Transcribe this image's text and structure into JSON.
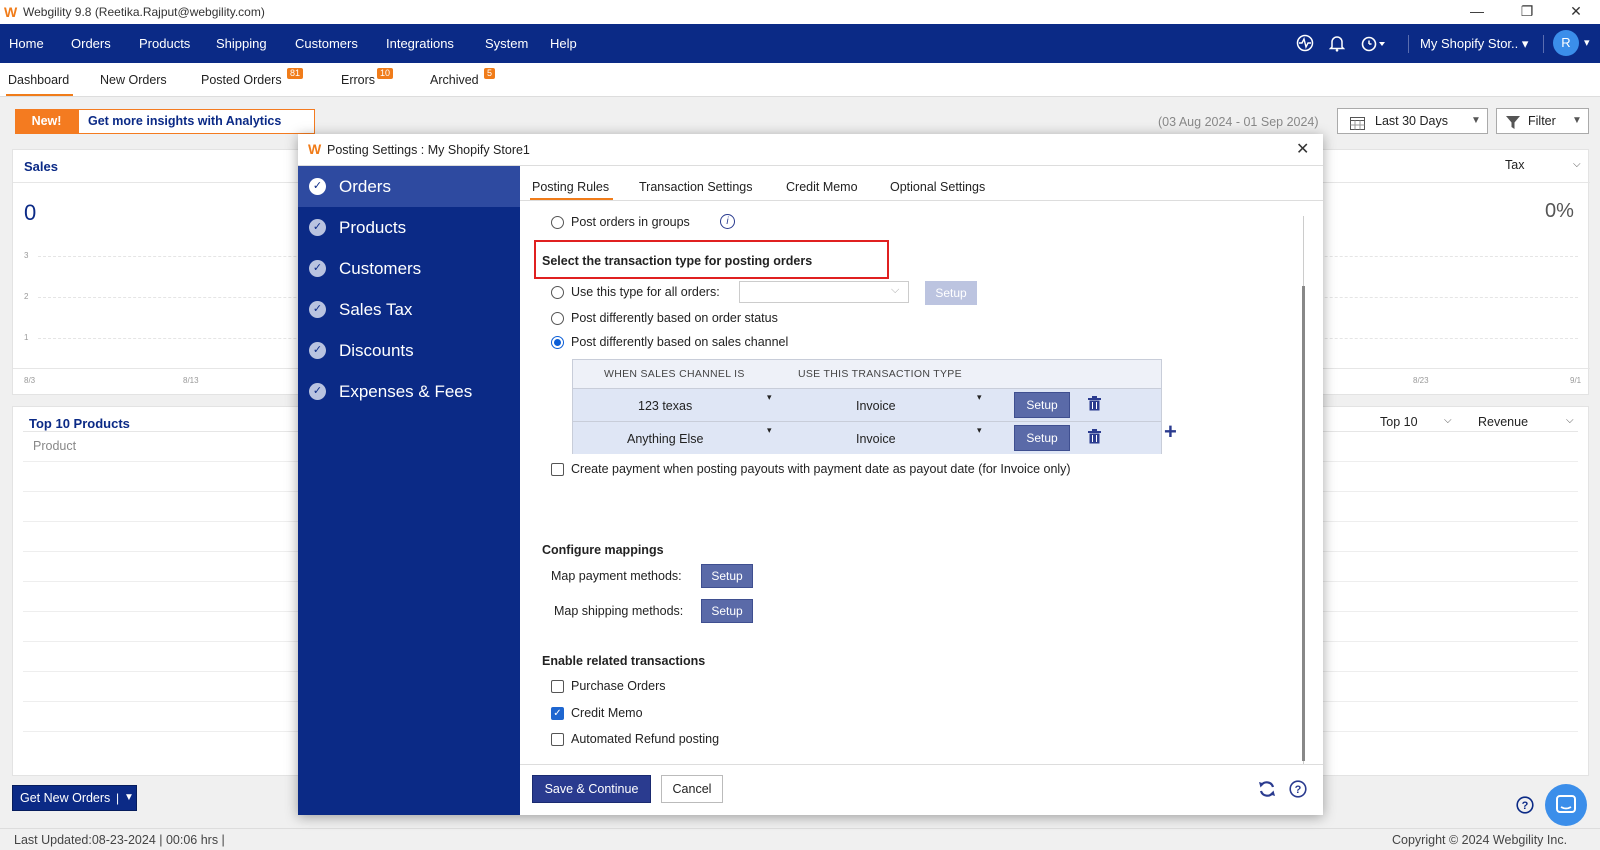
{
  "window": {
    "title": "Webgility 9.8 (Reetika.Rajput@webgility.com)",
    "minimize": "—",
    "restore": "❐",
    "close": "✕"
  },
  "nav": {
    "items": [
      "Home",
      "Orders",
      "Products",
      "Shipping",
      "Customers",
      "Integrations",
      "System",
      "Help"
    ],
    "store": "My Shopify Stor.. ▾",
    "avatar": "R"
  },
  "subtabs": [
    {
      "label": "Dashboard",
      "badge": ""
    },
    {
      "label": "New Orders",
      "badge": ""
    },
    {
      "label": "Posted Orders",
      "badge": "81"
    },
    {
      "label": "Errors",
      "badge": "10"
    },
    {
      "label": "Archived",
      "badge": "5"
    }
  ],
  "dashboard": {
    "new_label": "New!",
    "insight_label": "Get more insights with Analytics",
    "date_range": "(03 Aug 2024 - 01 Sep 2024)",
    "period": "Last 30 Days",
    "filter": "Filter",
    "sales_title": "Sales",
    "sales_value": "0",
    "tax_label": "Tax",
    "tax_value": "0%",
    "y_ticks": [
      "3",
      "2",
      "1"
    ],
    "x_ticks_left": [
      "8/3",
      "8/13"
    ],
    "x_ticks_right": [
      "8/23",
      "9/1"
    ],
    "top_products_title": "Top 10 Products",
    "top_select": "Top 10",
    "revenue_select": "Revenue",
    "product_col": "Product",
    "get_orders": "Get New Orders",
    "last_updated": "Last Updated:08-23-2024 | 00:06 hrs |",
    "copyright": "Copyright © 2024 Webgility Inc."
  },
  "modal": {
    "title": "Posting Settings : My Shopify Store1",
    "sidebar": [
      "Orders",
      "Products",
      "Customers",
      "Sales Tax",
      "Discounts",
      "Expenses & Fees"
    ],
    "tabs": [
      "Posting Rules",
      "Transaction Settings",
      "Credit Memo",
      "Optional Settings"
    ],
    "post_groups": "Post orders in groups",
    "section_title": "Select the transaction type for posting orders",
    "opt_all": "Use this type for all orders:",
    "opt_status": "Post differently based on order status",
    "opt_channel": "Post differently based on sales channel",
    "setup": "Setup",
    "table": {
      "col1": "WHEN SALES CHANNEL IS",
      "col2": "USE THIS TRANSACTION TYPE",
      "rows": [
        {
          "channel": "123 texas",
          "type": "Invoice"
        },
        {
          "channel": "Anything Else",
          "type": "Invoice"
        }
      ]
    },
    "payout_checkbox": "Create payment when posting payouts with payment date as payout date (for Invoice only)",
    "mappings_title": "Configure mappings",
    "map_payment": "Map payment methods:",
    "map_shipping": "Map shipping methods:",
    "related_title": "Enable related transactions",
    "purchase_orders": "Purchase Orders",
    "credit_memo": "Credit Memo",
    "auto_refund": "Automated Refund posting",
    "save": "Save & Continue",
    "cancel": "Cancel"
  }
}
